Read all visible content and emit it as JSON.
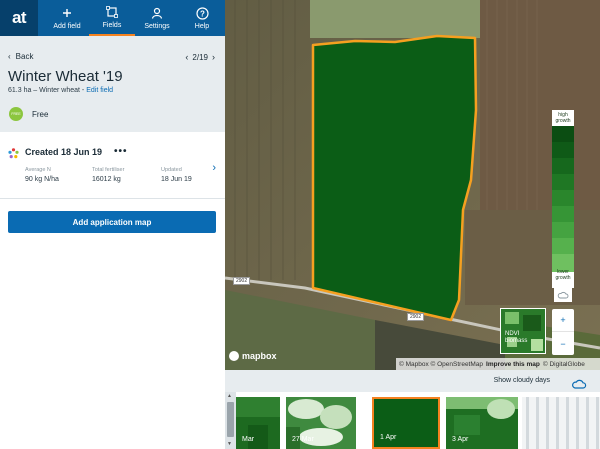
{
  "app": {
    "logo_text": "at"
  },
  "nav": [
    {
      "label": "Add field",
      "icon": "plus-icon"
    },
    {
      "label": "Fields",
      "icon": "field-square-icon",
      "active": true
    },
    {
      "label": "Settings",
      "icon": "person-icon"
    },
    {
      "label": "Help",
      "icon": "question-icon"
    }
  ],
  "header": {
    "back_label": "Back",
    "pager": "2/19",
    "title": "Winter Wheat '19",
    "subtitle": "61.3 ha – Winter wheat - ",
    "edit_link": "Edit field",
    "plan_badge": "FREE",
    "plan_label": "Free"
  },
  "application": {
    "created": "Created 18 Jun 19",
    "more": "•••",
    "stats": [
      {
        "label": "Average N",
        "value": "90 kg N/ha"
      },
      {
        "label": "Total fertiliser",
        "value": "16012 kg"
      },
      {
        "label": "Updated",
        "value": "18 Jun 19"
      }
    ]
  },
  "add_button": "Add application map",
  "map": {
    "legend_high": "high growth",
    "legend_low": "lower growth",
    "road_label": "2902",
    "ndvi_label_1": "NDVI",
    "ndvi_label_2": "biomass",
    "mapbox_logo": "mapbox",
    "attribution_1": "© Mapbox © OpenStreetMap",
    "attribution_link": "Improve this map",
    "attribution_2": "© DigitalGlobe",
    "zoom_in": "+",
    "zoom_out": "−",
    "colors": {
      "field": "#0b5d16",
      "boundary": "#f5a020",
      "accent": "#0a6bb3"
    }
  },
  "cloudy": {
    "label": "Show cloudy days"
  },
  "thumbnails": [
    {
      "date": "Mar",
      "style": "green"
    },
    {
      "date": "27 Mar",
      "style": "cloudy-green"
    },
    {
      "date": "1 Apr",
      "style": "dark",
      "selected": true
    },
    {
      "date": "3 Apr",
      "style": "mixed"
    },
    {
      "date": "",
      "style": "striped"
    }
  ]
}
